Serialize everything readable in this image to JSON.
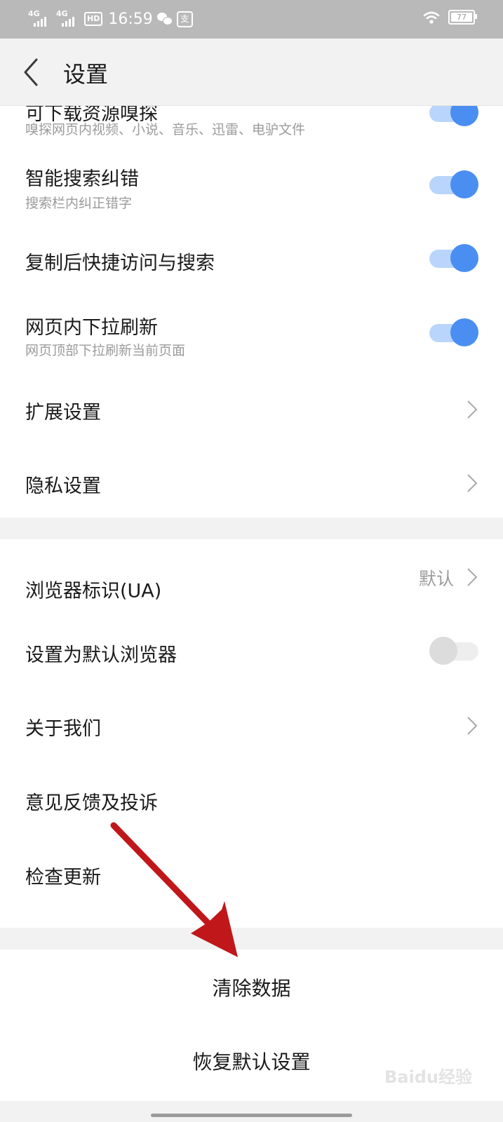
{
  "status_bar": {
    "signal1_label": "4G",
    "signal2_label": "4G",
    "hd_label": "HD",
    "time": "16:59",
    "app_label": "支",
    "battery": "77"
  },
  "header": {
    "title": "设置"
  },
  "settings_group1": [
    {
      "title": "可下载资源嗅探",
      "subtitle": "嗅探网页内视频、小说、音乐、迅雷、电驴文件",
      "control": "toggle",
      "on": true
    },
    {
      "title": "智能搜索纠错",
      "subtitle": "搜索栏内纠正错字",
      "control": "toggle",
      "on": true
    },
    {
      "title": "复制后快捷访问与搜索",
      "control": "toggle",
      "on": true
    },
    {
      "title": "网页内下拉刷新",
      "subtitle": "网页顶部下拉刷新当前页面",
      "control": "toggle",
      "on": true
    },
    {
      "title": "扩展设置",
      "control": "chevron"
    },
    {
      "title": "隐私设置",
      "control": "chevron"
    }
  ],
  "settings_group2": [
    {
      "title": "浏览器标识(UA)",
      "value": "默认",
      "control": "chevron"
    },
    {
      "title": "设置为默认浏览器",
      "control": "toggle",
      "on": false
    },
    {
      "title": "关于我们",
      "control": "chevron"
    },
    {
      "title": "意见反馈及投诉"
    },
    {
      "title": "检查更新"
    }
  ],
  "actions": {
    "clear_data": "清除数据",
    "restore_defaults": "恢复默认设置"
  },
  "watermark": "Baidu经验",
  "colors": {
    "toggle_on_knob": "#4a8ef2",
    "toggle_on_track": "#b9d5fb",
    "arrow": "#c0171a",
    "status_bar": "#b9b9b9"
  }
}
